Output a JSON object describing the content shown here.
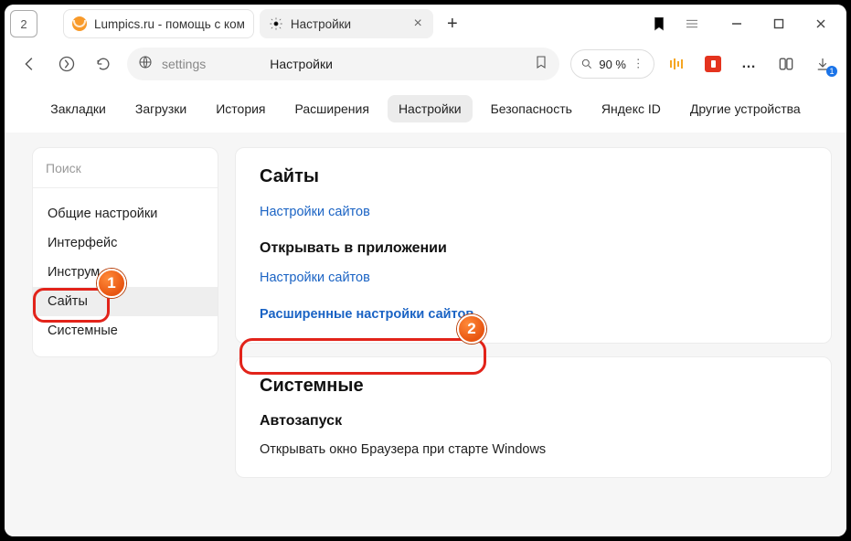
{
  "titlebar": {
    "counter": "2",
    "tabs": [
      {
        "title": "Lumpics.ru - помощь с ком",
        "icon": "lumpics-icon"
      },
      {
        "title": "Настройки",
        "icon": "gear-icon"
      }
    ]
  },
  "addrbar": {
    "path": "settings",
    "page_title": "Настройки",
    "zoom": "90 %"
  },
  "subnav": {
    "items": [
      "Закладки",
      "Загрузки",
      "История",
      "Расширения",
      "Настройки",
      "Безопасность",
      "Яндекс ID",
      "Другие устройства"
    ],
    "active_index": 4
  },
  "sidebar": {
    "search_placeholder": "Поиск",
    "items": [
      "Общие настройки",
      "Интерфейс",
      "Инструм",
      "Сайты",
      "Системные"
    ],
    "active_index": 3
  },
  "content": {
    "card1": {
      "heading": "Сайты",
      "link1": "Настройки сайтов",
      "sub_heading": "Открывать в приложении",
      "link2": "Настройки сайтов",
      "link3": "Расширенные настройки сайтов"
    },
    "card2": {
      "heading": "Системные",
      "sub_heading": "Автозапуск",
      "text": "Открывать окно Браузера при старте Windows"
    }
  },
  "downloads_badge": "1",
  "annotations": {
    "n1": "1",
    "n2": "2"
  }
}
